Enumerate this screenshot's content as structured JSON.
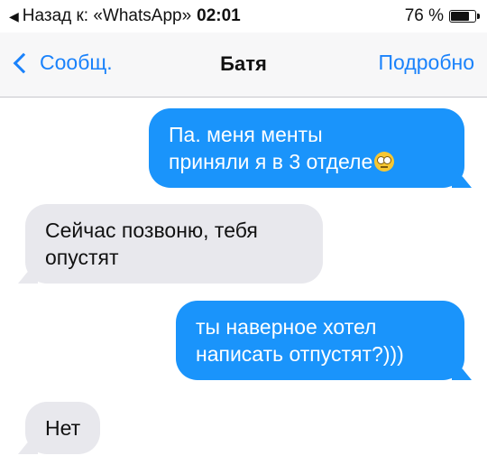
{
  "status_bar": {
    "back_text": "Назад к: «WhatsApp»",
    "time": "02:01",
    "battery_text": "76 %",
    "battery_level": 0.76
  },
  "nav": {
    "back_label": "Сообщ.",
    "title": "Батя",
    "details_label": "Подробно"
  },
  "messages": [
    {
      "direction": "outgoing",
      "lines": [
        "Па. меня менты",
        "приняли я в 3 отделе"
      ],
      "emoji": "face-with-rolling-eyes"
    },
    {
      "direction": "incoming",
      "lines": [
        "Сейчас позвоню, тебя",
        "опустят"
      ]
    },
    {
      "direction": "outgoing",
      "lines": [
        "ты наверное хотел",
        "написать отпустят?)))"
      ]
    },
    {
      "direction": "incoming",
      "lines": [
        "Нет"
      ]
    }
  ],
  "colors": {
    "accent": "#1a82fb",
    "outgoing_bubble": "#1a94fb",
    "incoming_bubble": "#e8e8ed"
  }
}
